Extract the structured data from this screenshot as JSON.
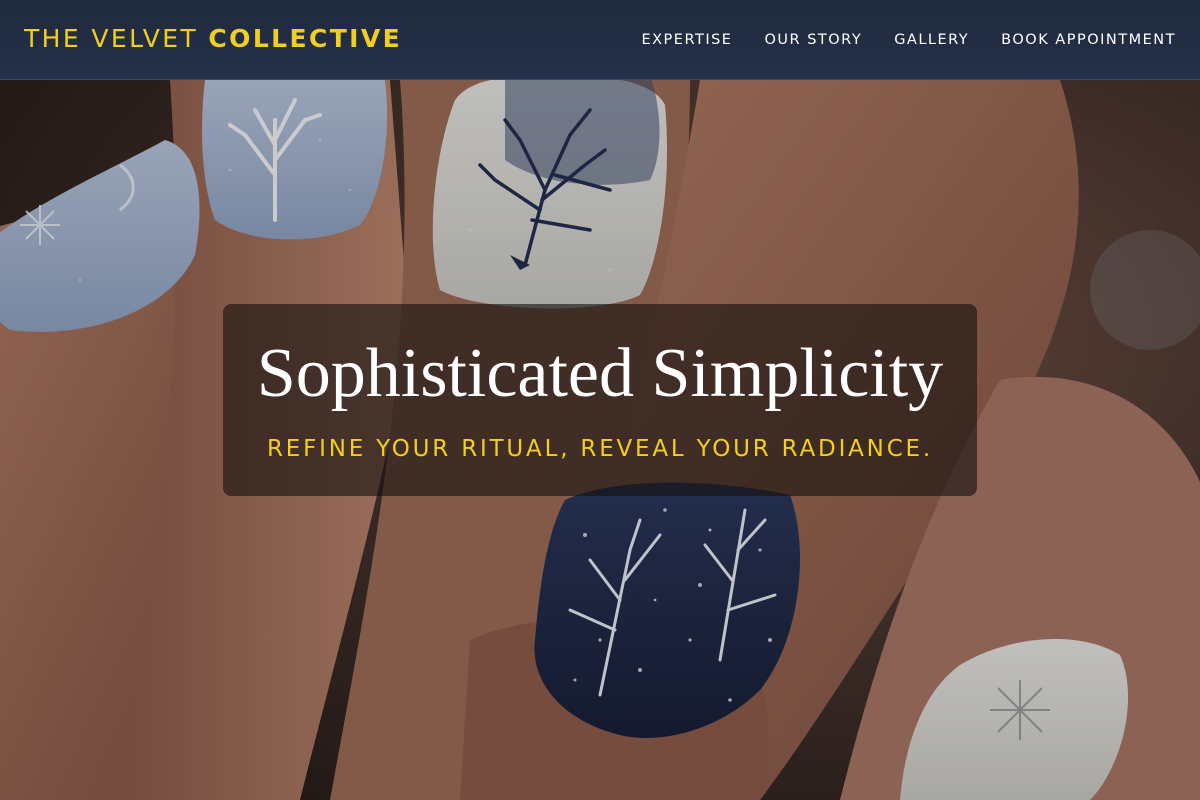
{
  "header": {
    "brand_light": "THE VELVET",
    "brand_bold": "COLLECTIVE",
    "nav": [
      {
        "label": "EXPERTISE"
      },
      {
        "label": "OUR STORY"
      },
      {
        "label": "GALLERY"
      },
      {
        "label": "BOOK APPOINTMENT"
      }
    ]
  },
  "hero": {
    "title": "Sophisticated Simplicity",
    "tagline": "REFINE YOUR RITUAL, REVEAL YOUR RADIANCE.",
    "image_subject": "winter-tree-nail-art"
  },
  "colors": {
    "header_bg": "#1f2a3d",
    "accent_gold": "#f2cf1e",
    "nail_light_blue": "#a9b9d4",
    "nail_navy": "#1c2747",
    "nail_ivory": "#dcdcd6"
  }
}
